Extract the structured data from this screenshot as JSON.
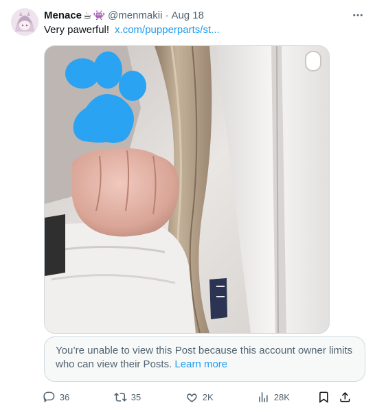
{
  "post": {
    "author": {
      "display_name": "Menace",
      "emojis": [
        "☕",
        "👾"
      ],
      "handle": "@menmakii",
      "separator": "·",
      "date": "Aug 18"
    },
    "text": "Very pawerful!",
    "link_text": "x.com/pupperparts/st...",
    "media": {
      "description_icon": "photo",
      "overlay_icon": "paw-print-icon"
    },
    "notice": {
      "message": "You’re unable to view this Post because this account owner limits who can view their Posts.",
      "learn_more": "Learn more"
    },
    "actions": {
      "replies": "36",
      "reposts": "35",
      "likes": "2K",
      "views": "28K"
    }
  },
  "colors": {
    "accent": "#1d9bf0",
    "secondary_text": "#536471",
    "border": "#cfd9de",
    "notice_bg": "#f7f9f9"
  }
}
